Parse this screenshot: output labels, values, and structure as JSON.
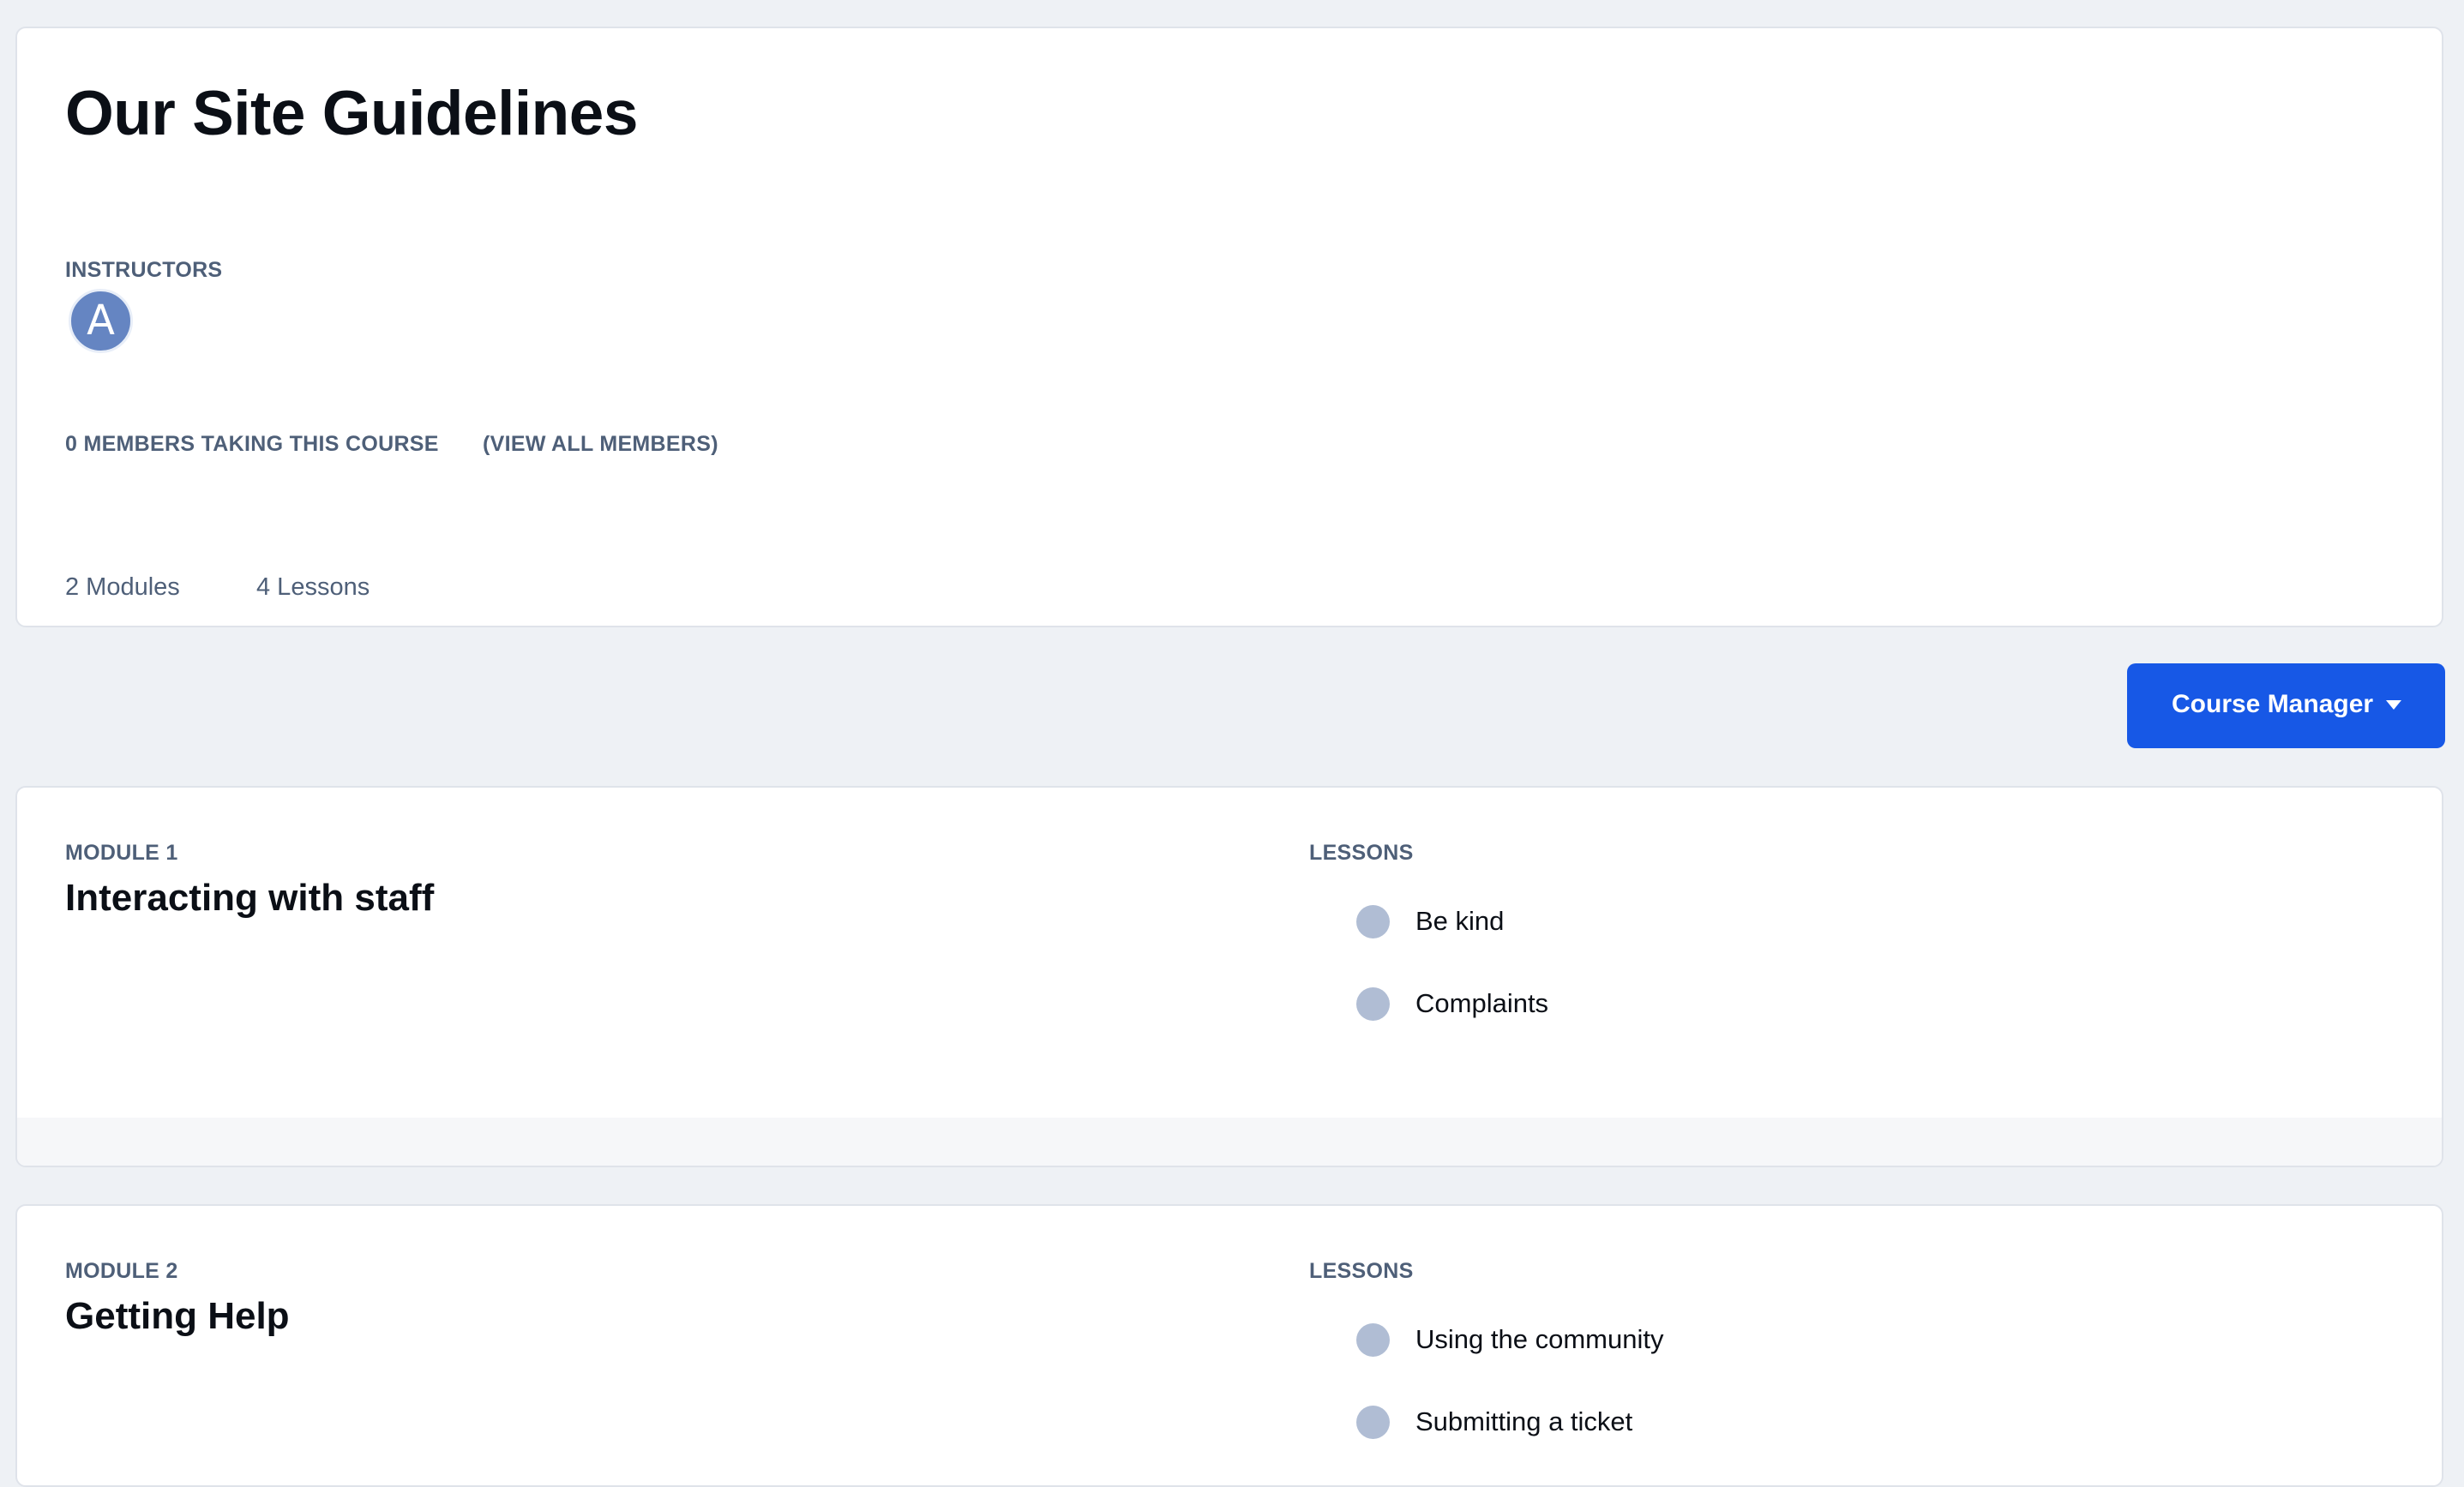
{
  "course": {
    "title": "Our Site Guidelines",
    "instructors_label": "INSTRUCTORS",
    "instructor_avatar_initial": "A",
    "members_count": "0 MEMBERS TAKING THIS COURSE",
    "view_all_members": "(VIEW ALL MEMBERS)",
    "modules_count": "2 Modules",
    "lessons_count": "4 Lessons"
  },
  "toolbar": {
    "course_manager_label": "Course Manager"
  },
  "modules": [
    {
      "eyebrow": "MODULE 1",
      "title": "Interacting with staff",
      "lessons_label": "LESSONS",
      "lessons": [
        {
          "label": "Be kind"
        },
        {
          "label": "Complaints"
        }
      ]
    },
    {
      "eyebrow": "MODULE 2",
      "title": "Getting Help",
      "lessons_label": "LESSONS",
      "lessons": [
        {
          "label": "Using the community"
        },
        {
          "label": "Submitting a ticket"
        }
      ]
    }
  ],
  "colors": {
    "page_background": "#eef1f5",
    "accent": "#1758e6",
    "avatar": "#6585c2",
    "lesson_status_dot": "#b0bdd4",
    "muted_text": "#4e5f78"
  }
}
